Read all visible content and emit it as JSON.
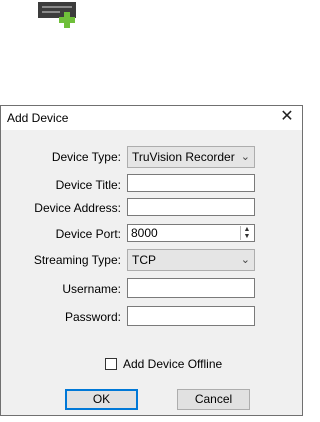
{
  "dialog": {
    "title": "Add Device",
    "close_glyph": "✕",
    "fields": {
      "device_type": {
        "label": "Device Type:",
        "value": "TruVision Recorder"
      },
      "device_title": {
        "label": "Device Title:",
        "value": ""
      },
      "device_address": {
        "label": "Device Address:",
        "value": ""
      },
      "device_port": {
        "label": "Device Port:",
        "value": "8000"
      },
      "streaming_type": {
        "label": "Streaming Type:",
        "value": "TCP"
      },
      "username": {
        "label": "Username:",
        "value": ""
      },
      "password": {
        "label": "Password:",
        "value": ""
      }
    },
    "offline_checkbox": {
      "label": "Add Device Offline",
      "checked": false
    },
    "buttons": {
      "ok": "OK",
      "cancel": "Cancel"
    }
  },
  "icons": {
    "toolbar": "add-device-icon",
    "chevron": "chevron-down-icon"
  },
  "colors": {
    "accent": "#0078d7",
    "plus": "#6fbf3a"
  }
}
